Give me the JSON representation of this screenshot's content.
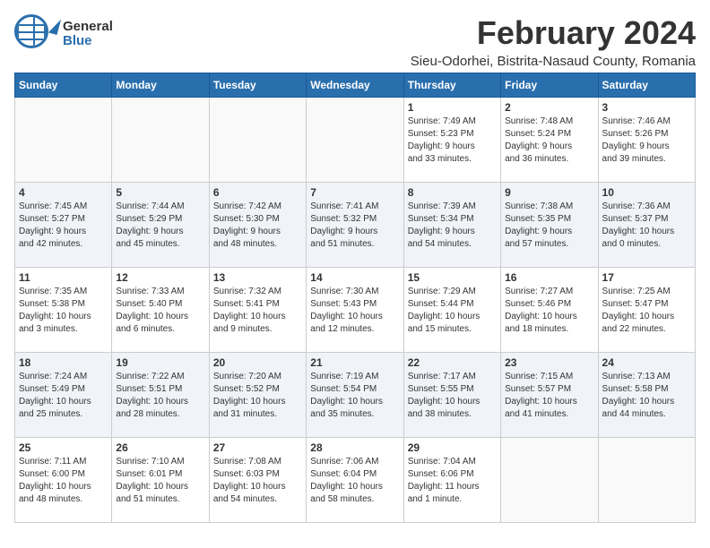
{
  "header": {
    "logo_general": "General",
    "logo_blue": "Blue",
    "month_title": "February 2024",
    "location": "Sieu-Odorhei, Bistrita-Nasaud County, Romania"
  },
  "weekdays": [
    "Sunday",
    "Monday",
    "Tuesday",
    "Wednesday",
    "Thursday",
    "Friday",
    "Saturday"
  ],
  "weeks": [
    [
      {
        "day": "",
        "info": ""
      },
      {
        "day": "",
        "info": ""
      },
      {
        "day": "",
        "info": ""
      },
      {
        "day": "",
        "info": ""
      },
      {
        "day": "1",
        "info": "Sunrise: 7:49 AM\nSunset: 5:23 PM\nDaylight: 9 hours\nand 33 minutes."
      },
      {
        "day": "2",
        "info": "Sunrise: 7:48 AM\nSunset: 5:24 PM\nDaylight: 9 hours\nand 36 minutes."
      },
      {
        "day": "3",
        "info": "Sunrise: 7:46 AM\nSunset: 5:26 PM\nDaylight: 9 hours\nand 39 minutes."
      }
    ],
    [
      {
        "day": "4",
        "info": "Sunrise: 7:45 AM\nSunset: 5:27 PM\nDaylight: 9 hours\nand 42 minutes."
      },
      {
        "day": "5",
        "info": "Sunrise: 7:44 AM\nSunset: 5:29 PM\nDaylight: 9 hours\nand 45 minutes."
      },
      {
        "day": "6",
        "info": "Sunrise: 7:42 AM\nSunset: 5:30 PM\nDaylight: 9 hours\nand 48 minutes."
      },
      {
        "day": "7",
        "info": "Sunrise: 7:41 AM\nSunset: 5:32 PM\nDaylight: 9 hours\nand 51 minutes."
      },
      {
        "day": "8",
        "info": "Sunrise: 7:39 AM\nSunset: 5:34 PM\nDaylight: 9 hours\nand 54 minutes."
      },
      {
        "day": "9",
        "info": "Sunrise: 7:38 AM\nSunset: 5:35 PM\nDaylight: 9 hours\nand 57 minutes."
      },
      {
        "day": "10",
        "info": "Sunrise: 7:36 AM\nSunset: 5:37 PM\nDaylight: 10 hours\nand 0 minutes."
      }
    ],
    [
      {
        "day": "11",
        "info": "Sunrise: 7:35 AM\nSunset: 5:38 PM\nDaylight: 10 hours\nand 3 minutes."
      },
      {
        "day": "12",
        "info": "Sunrise: 7:33 AM\nSunset: 5:40 PM\nDaylight: 10 hours\nand 6 minutes."
      },
      {
        "day": "13",
        "info": "Sunrise: 7:32 AM\nSunset: 5:41 PM\nDaylight: 10 hours\nand 9 minutes."
      },
      {
        "day": "14",
        "info": "Sunrise: 7:30 AM\nSunset: 5:43 PM\nDaylight: 10 hours\nand 12 minutes."
      },
      {
        "day": "15",
        "info": "Sunrise: 7:29 AM\nSunset: 5:44 PM\nDaylight: 10 hours\nand 15 minutes."
      },
      {
        "day": "16",
        "info": "Sunrise: 7:27 AM\nSunset: 5:46 PM\nDaylight: 10 hours\nand 18 minutes."
      },
      {
        "day": "17",
        "info": "Sunrise: 7:25 AM\nSunset: 5:47 PM\nDaylight: 10 hours\nand 22 minutes."
      }
    ],
    [
      {
        "day": "18",
        "info": "Sunrise: 7:24 AM\nSunset: 5:49 PM\nDaylight: 10 hours\nand 25 minutes."
      },
      {
        "day": "19",
        "info": "Sunrise: 7:22 AM\nSunset: 5:51 PM\nDaylight: 10 hours\nand 28 minutes."
      },
      {
        "day": "20",
        "info": "Sunrise: 7:20 AM\nSunset: 5:52 PM\nDaylight: 10 hours\nand 31 minutes."
      },
      {
        "day": "21",
        "info": "Sunrise: 7:19 AM\nSunset: 5:54 PM\nDaylight: 10 hours\nand 35 minutes."
      },
      {
        "day": "22",
        "info": "Sunrise: 7:17 AM\nSunset: 5:55 PM\nDaylight: 10 hours\nand 38 minutes."
      },
      {
        "day": "23",
        "info": "Sunrise: 7:15 AM\nSunset: 5:57 PM\nDaylight: 10 hours\nand 41 minutes."
      },
      {
        "day": "24",
        "info": "Sunrise: 7:13 AM\nSunset: 5:58 PM\nDaylight: 10 hours\nand 44 minutes."
      }
    ],
    [
      {
        "day": "25",
        "info": "Sunrise: 7:11 AM\nSunset: 6:00 PM\nDaylight: 10 hours\nand 48 minutes."
      },
      {
        "day": "26",
        "info": "Sunrise: 7:10 AM\nSunset: 6:01 PM\nDaylight: 10 hours\nand 51 minutes."
      },
      {
        "day": "27",
        "info": "Sunrise: 7:08 AM\nSunset: 6:03 PM\nDaylight: 10 hours\nand 54 minutes."
      },
      {
        "day": "28",
        "info": "Sunrise: 7:06 AM\nSunset: 6:04 PM\nDaylight: 10 hours\nand 58 minutes."
      },
      {
        "day": "29",
        "info": "Sunrise: 7:04 AM\nSunset: 6:06 PM\nDaylight: 11 hours\nand 1 minute."
      },
      {
        "day": "",
        "info": ""
      },
      {
        "day": "",
        "info": ""
      }
    ]
  ]
}
